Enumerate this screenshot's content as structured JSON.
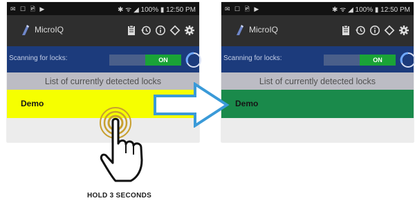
{
  "screens": [
    {
      "status": {
        "left_icons": "✉ ☐ 🖻 ▶",
        "right_text": "✱ ᯤ ◢ 100% ▮ 12:50 PM"
      },
      "app_title": "MicroIQ",
      "actions": [
        "clipboard-icon",
        "history-icon",
        "info-icon",
        "diamond-icon",
        "gear-icon"
      ],
      "scan": {
        "label": "Scanning for locks:",
        "toggle_label": "ON",
        "enabled": true
      },
      "list_header": "List of currently detected locks",
      "locks": [
        {
          "name": "Demo",
          "highlight_color": "#f6ff00"
        }
      ]
    },
    {
      "status": {
        "left_icons": "✉ ☐ 🖻 ▶",
        "right_text": "✱ ᯤ ◢ 100% ▮ 12:50 PM"
      },
      "app_title": "MicroIQ",
      "actions": [
        "clipboard-icon",
        "history-icon",
        "info-icon",
        "diamond-icon",
        "gear-icon"
      ],
      "scan": {
        "label": "Scanning for locks:",
        "toggle_label": "ON",
        "enabled": true
      },
      "list_header": "List of currently detected locks",
      "locks": [
        {
          "name": "Demo",
          "highlight_color": "#1a8a4b"
        }
      ]
    }
  ],
  "instruction": "HOLD 3 SECONDS",
  "colors": {
    "arrow_fill": "#ffffff",
    "arrow_stroke": "#3a9ad8"
  }
}
